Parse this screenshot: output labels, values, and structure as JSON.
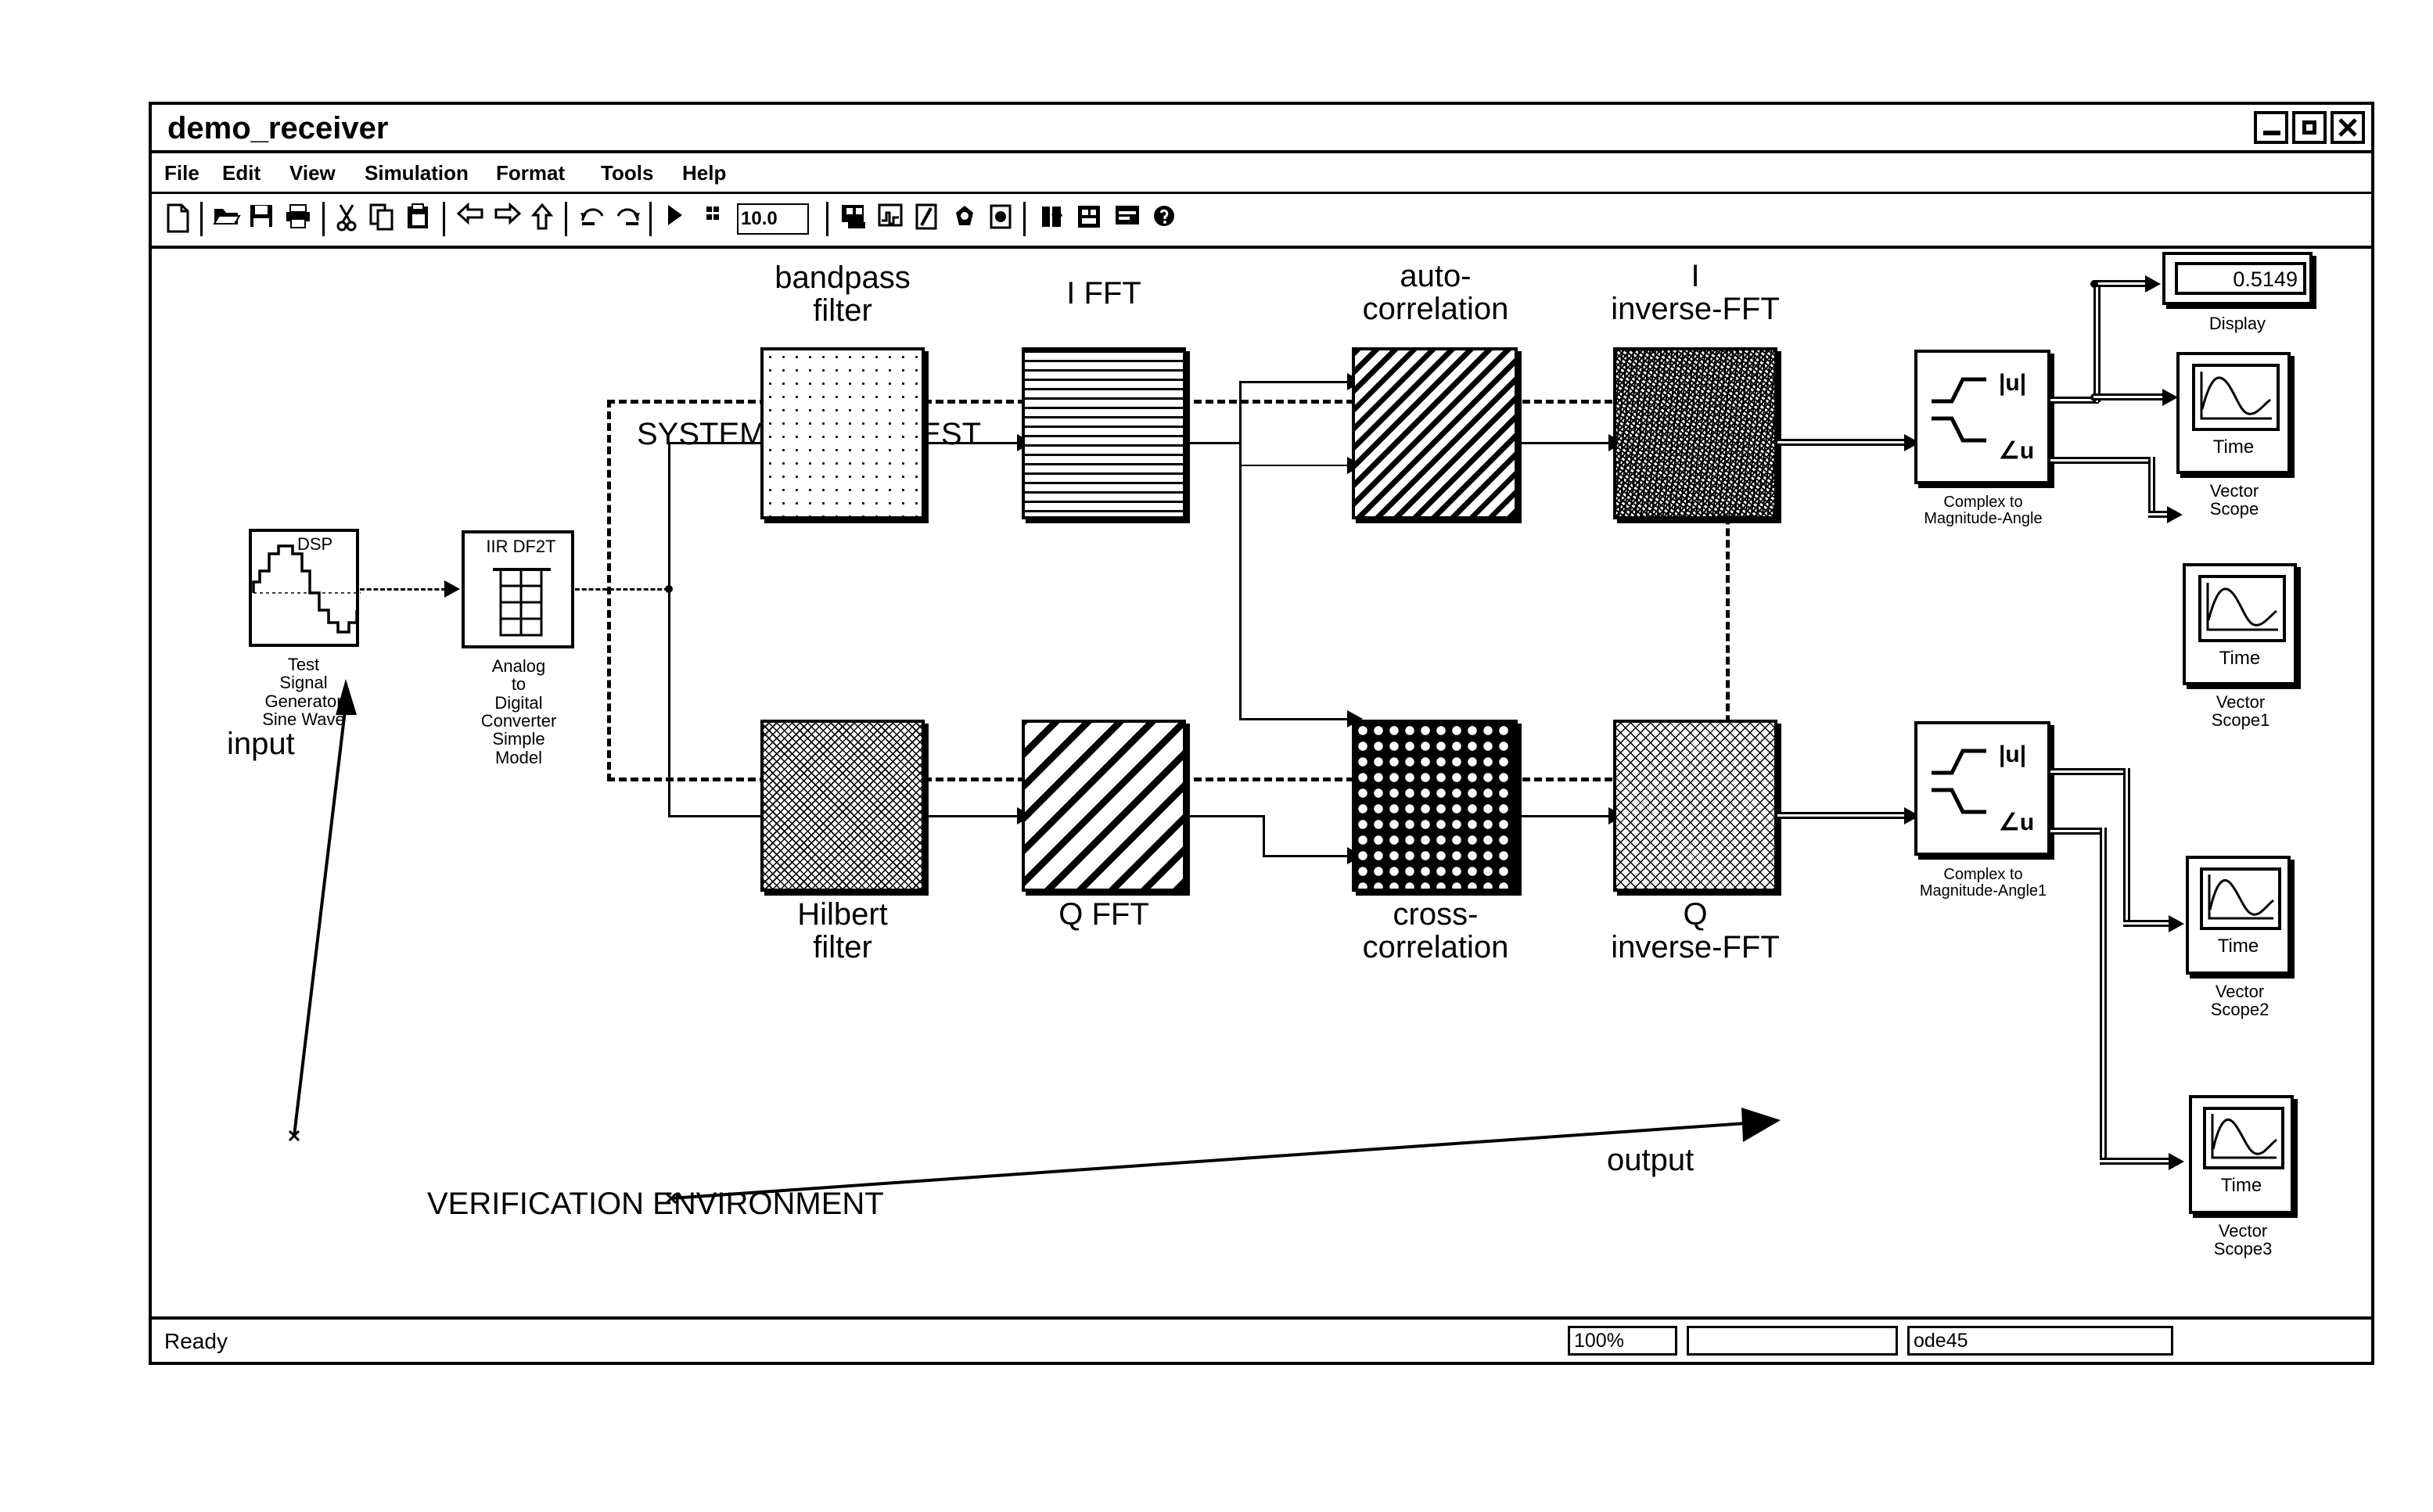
{
  "window": {
    "title": "demo_receiver",
    "controls": [
      {
        "name": "minimize",
        "glyph": "_"
      },
      {
        "name": "maximize",
        "glyph": "□"
      },
      {
        "name": "close",
        "glyph": "✕"
      }
    ]
  },
  "menubar": {
    "items": [
      "File",
      "Edit",
      "View",
      "Simulation",
      "Format",
      "Tools",
      "Help"
    ]
  },
  "toolbar": {
    "sim_time": "10.0",
    "icons": [
      "new-model-icon",
      "open-model-icon",
      "save-icon",
      "print-icon",
      "cut-icon",
      "copy-icon",
      "paste-icon",
      "undo-arrow-icon",
      "redo-arrow-icon",
      "go-up-icon",
      "undo-icon",
      "redo-icon",
      "start-simulation-icon",
      "stop-simulation-icon",
      "build-model-icon",
      "toggle-scope-icon",
      "model-explorer-icon",
      "update-diagram-icon",
      "debug-icon",
      "library-browser-icon",
      "model-browser-icon",
      "block-help-icon",
      "signal-help-icon"
    ]
  },
  "statusbar": {
    "status": "Ready",
    "zoom": "100%",
    "middle": "",
    "solver": "ode45"
  },
  "diagram": {
    "annotations": {
      "system_of_interest": "SYSTEM OF INTEREST",
      "verification_environment": "VERIFICATION ENVIRONMENT",
      "input": "input",
      "output": "output"
    },
    "source_block": {
      "badge": "DSP",
      "caption": "Test\nSignal\nGenerator\nSine Wave",
      "icon": "sine-wave-staircase-icon"
    },
    "adc_block": {
      "badge": "IIR DF2T",
      "caption": "Analog\nto\nDigital\nConverter\nSimple\nModel",
      "icon": "filter-grid-icon"
    },
    "processing_blocks": [
      {
        "label": "bandpass\nfilter",
        "label_pos": "above",
        "pattern": "dots",
        "data_name": "bandpass-filter-block"
      },
      {
        "label": "I FFT",
        "label_pos": "above",
        "pattern": "horizontal-lines",
        "data_name": "i-fft-block"
      },
      {
        "label": "auto-\ncorrelation",
        "label_pos": "above",
        "pattern": "dense-diagonal",
        "data_name": "auto-correlation-block"
      },
      {
        "label": "I\ninverse-FFT",
        "label_pos": "above",
        "pattern": "speckle",
        "data_name": "i-inverse-fft-block"
      },
      {
        "label": "Hilbert\nfilter",
        "label_pos": "below",
        "pattern": "fine-crosshatch",
        "data_name": "hilbert-filter-block"
      },
      {
        "label": "Q FFT",
        "label_pos": "below",
        "pattern": "wide-diagonal",
        "data_name": "q-fft-block"
      },
      {
        "label": "cross-\ncorrelation",
        "label_pos": "below",
        "pattern": "dark-grid",
        "data_name": "cross-correlation-block"
      },
      {
        "label": "Q\ninverse-FFT",
        "label_pos": "below",
        "pattern": "light-crosshatch",
        "data_name": "q-inverse-fft-block"
      }
    ],
    "converters": [
      {
        "caption": "Complex to\nMagnitude-Angle",
        "sym_mag": "|u|",
        "sym_ang": "∠u"
      },
      {
        "caption": "Complex to\nMagnitude-Angle1",
        "sym_mag": "|u|",
        "sym_ang": "∠u"
      }
    ],
    "display": {
      "value": "0.5149",
      "caption": "Display"
    },
    "scopes": [
      {
        "inner_label": "Time",
        "caption": "Vector\nScope"
      },
      {
        "inner_label": "Time",
        "caption": "Vector\nScope1"
      },
      {
        "inner_label": "Time",
        "caption": "Vector\nScope2"
      },
      {
        "inner_label": "Time",
        "caption": "Vector\nScope3"
      }
    ]
  },
  "colors": {
    "ink": "#000000",
    "paper": "#ffffff"
  }
}
